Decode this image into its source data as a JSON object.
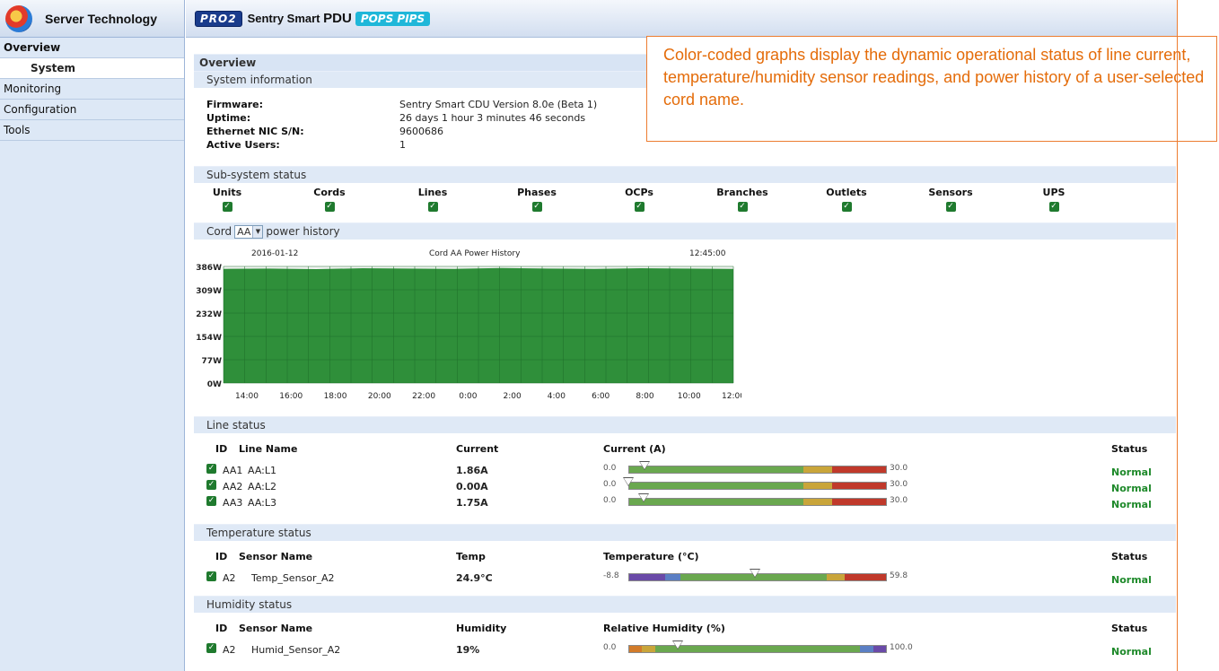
{
  "brand": {
    "name": "Server Technology",
    "logo_icon": "server-technology-logo-icon"
  },
  "header": {
    "badge_left": "PRO2",
    "product_prefix": "Sentry Smart",
    "product_bold": "PDU",
    "badge_right": "POPS PIPS"
  },
  "sidebar": {
    "items": [
      {
        "label": "Overview",
        "active": true
      },
      {
        "label": "System",
        "sub": true
      },
      {
        "label": "Monitoring"
      },
      {
        "label": "Configuration"
      },
      {
        "label": "Tools"
      }
    ]
  },
  "overview": {
    "title": "Overview"
  },
  "system_info": {
    "title": "System information",
    "rows": [
      {
        "key": "Firmware:",
        "value": "Sentry Smart CDU Version 8.0e (Beta 1)"
      },
      {
        "key": "Uptime:",
        "value": "26 days 1 hour 3 minutes 46 seconds"
      },
      {
        "key": "Ethernet NIC S/N:",
        "value": "9600686"
      },
      {
        "key": "Active Users:",
        "value": "1"
      }
    ]
  },
  "subsystem": {
    "title": "Sub-system status",
    "items": [
      "Units",
      "Cords",
      "Lines",
      "Phases",
      "OCPs",
      "Branches",
      "Outlets",
      "Sensors",
      "UPS"
    ]
  },
  "cord": {
    "prefix": "Cord",
    "selected": "AA",
    "suffix": "power history"
  },
  "chart_data": {
    "type": "area",
    "title": "Cord AA Power History",
    "date_label": "2016-01-12",
    "time_label": "12:45:00",
    "xlabel": "",
    "ylabel": "",
    "x": [
      "14:00",
      "16:00",
      "18:00",
      "20:00",
      "22:00",
      "0:00",
      "2:00",
      "4:00",
      "6:00",
      "8:00",
      "10:00",
      "12:00"
    ],
    "y_ticks": [
      "0W",
      "77W",
      "154W",
      "232W",
      "309W",
      "386W"
    ],
    "ylim": [
      0,
      386
    ],
    "values": [
      378,
      379,
      377,
      380,
      379,
      378,
      381,
      379,
      378,
      380,
      379,
      378
    ],
    "grid": true,
    "fill_color": "#2f8f3a"
  },
  "line_status": {
    "title": "Line status",
    "headers": {
      "id": "ID",
      "name": "Line Name",
      "current": "Current",
      "gauge": "Current (A)",
      "status": "Status"
    },
    "rows": [
      {
        "id": "AA1",
        "name": "AA:L1",
        "current": "1.86A",
        "min": "0.0",
        "max": "30.0",
        "value": 1.86,
        "status": "Normal"
      },
      {
        "id": "AA2",
        "name": "AA:L2",
        "current": "0.00A",
        "min": "0.0",
        "max": "30.0",
        "value": 0.0,
        "status": "Normal"
      },
      {
        "id": "AA3",
        "name": "AA:L3",
        "current": "1.75A",
        "min": "0.0",
        "max": "30.0",
        "value": 1.75,
        "status": "Normal"
      }
    ]
  },
  "temp_status": {
    "title": "Temperature status",
    "headers": {
      "id": "ID",
      "name": "Sensor Name",
      "value": "Temp",
      "gauge": "Temperature (°C)",
      "status": "Status"
    },
    "rows": [
      {
        "id": "A2",
        "name": "Temp_Sensor_A2",
        "value_text": "24.9°C",
        "min": "-8.8",
        "max": "59.8",
        "value": 24.9,
        "status": "Normal"
      }
    ]
  },
  "humid_status": {
    "title": "Humidity status",
    "headers": {
      "id": "ID",
      "name": "Sensor Name",
      "value": "Humidity",
      "gauge": "Relative Humidity (%)",
      "status": "Status"
    },
    "rows": [
      {
        "id": "A2",
        "name": "Humid_Sensor_A2",
        "value_text": "19%",
        "min": "0.0",
        "max": "100.0",
        "value": 19,
        "status": "Normal"
      }
    ]
  },
  "callout": {
    "text": "Color-coded graphs display the dynamic operational status of line current, temperature/humidity sensor readings, and power history of a user-selected cord name."
  },
  "colors": {
    "ok": "#1f8a2b",
    "gauge_green": "#6aa84f",
    "gauge_yellow": "#c9a53a",
    "gauge_red": "#c0392b",
    "gauge_purple": "#6a4aa8",
    "gauge_blue": "#5b7fc4",
    "gauge_orange": "#d27b2a",
    "accent": "#ed7d31"
  }
}
